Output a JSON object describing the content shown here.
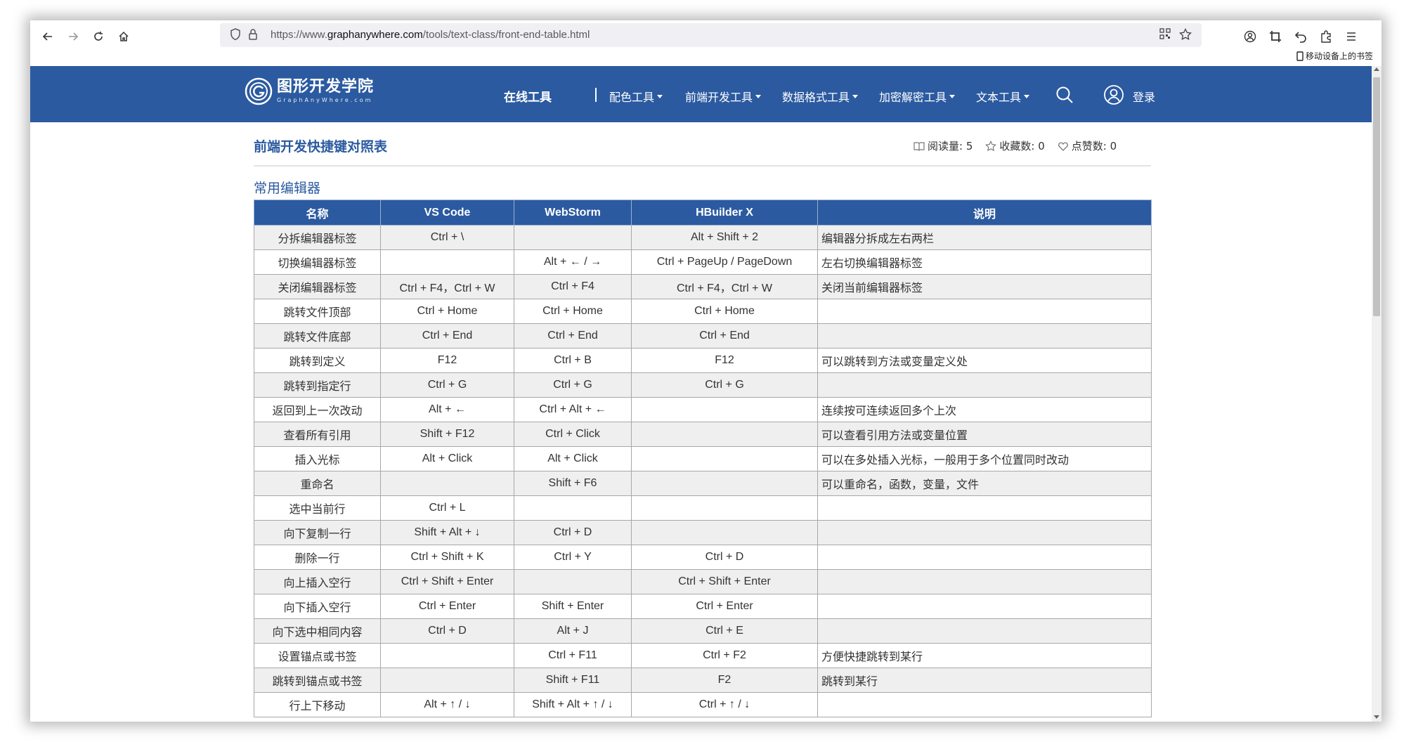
{
  "browser": {
    "url_prefix": "https://www.",
    "url_domain": "graphanywhere.com",
    "url_path": "/tools/text-class/front-end-table.html",
    "mobile_bookmarks": "移动设备上的书签"
  },
  "site": {
    "logo_cn": "图形开发学院",
    "logo_en": "GraphAnyWhere.com",
    "nav_main": "在线工具",
    "nav_items": [
      "配色工具",
      "前端开发工具",
      "数据格式工具",
      "加密解密工具",
      "文本工具"
    ],
    "login": "登录",
    "brand_color": "#2b5aa0"
  },
  "article": {
    "title": "前端开发快捷键对照表",
    "read_label": "阅读量: 5",
    "fav_label": "收藏数: 0",
    "like_label": "点赞数: 0",
    "section_title": "常用编辑器"
  },
  "table": {
    "headers": [
      "名称",
      "VS Code",
      "WebStorm",
      "HBuilder X",
      "说明"
    ],
    "rows": [
      [
        "分拆编辑器标签",
        "Ctrl + \\",
        "",
        "Alt + Shift + 2",
        "编辑器分拆成左右两栏"
      ],
      [
        "切换编辑器标签",
        "",
        "Alt + ← / →",
        "Ctrl + PageUp / PageDown",
        "左右切换编辑器标签"
      ],
      [
        "关闭编辑器标签",
        "Ctrl + F4，Ctrl + W",
        "Ctrl + F4",
        "Ctrl + F4，Ctrl + W",
        "关闭当前编辑器标签"
      ],
      [
        "跳转文件顶部",
        "Ctrl + Home",
        "Ctrl + Home",
        "Ctrl + Home",
        ""
      ],
      [
        "跳转文件底部",
        "Ctrl + End",
        "Ctrl + End",
        "Ctrl + End",
        ""
      ],
      [
        "跳转到定义",
        "F12",
        "Ctrl + B",
        "F12",
        "可以跳转到方法或变量定义处"
      ],
      [
        "跳转到指定行",
        "Ctrl + G",
        "Ctrl + G",
        "Ctrl + G",
        ""
      ],
      [
        "返回到上一次改动",
        "Alt + ←",
        "Ctrl + Alt + ←",
        "",
        "连续按可连续返回多个上次"
      ],
      [
        "查看所有引用",
        "Shift + F12",
        "Ctrl + Click",
        "",
        "可以查看引用方法或变量位置"
      ],
      [
        "插入光标",
        "Alt + Click",
        "Alt + Click",
        "",
        "可以在多处插入光标，一般用于多个位置同时改动"
      ],
      [
        "重命名",
        "",
        "Shift + F6",
        "",
        "可以重命名，函数，变量，文件"
      ],
      [
        "选中当前行",
        "Ctrl + L",
        "",
        "",
        ""
      ],
      [
        "向下复制一行",
        "Shift + Alt + ↓",
        "Ctrl + D",
        "",
        ""
      ],
      [
        "删除一行",
        "Ctrl + Shift + K",
        "Ctrl + Y",
        "Ctrl + D",
        ""
      ],
      [
        "向上插入空行",
        "Ctrl + Shift + Enter",
        "",
        "Ctrl + Shift + Enter",
        ""
      ],
      [
        "向下插入空行",
        "Ctrl + Enter",
        "Shift + Enter",
        "Ctrl + Enter",
        ""
      ],
      [
        "向下选中相同内容",
        "Ctrl + D",
        "Alt + J",
        "Ctrl + E",
        ""
      ],
      [
        "设置锚点或书签",
        "",
        "Ctrl + F11",
        "Ctrl + F2",
        "方便快捷跳转到某行"
      ],
      [
        "跳转到锚点或书签",
        "",
        "Shift + F11",
        "F2",
        "跳转到某行"
      ],
      [
        "行上下移动",
        "Alt + ↑ / ↓",
        "Shift + Alt + ↑ / ↓",
        "Ctrl + ↑ / ↓",
        ""
      ]
    ]
  }
}
